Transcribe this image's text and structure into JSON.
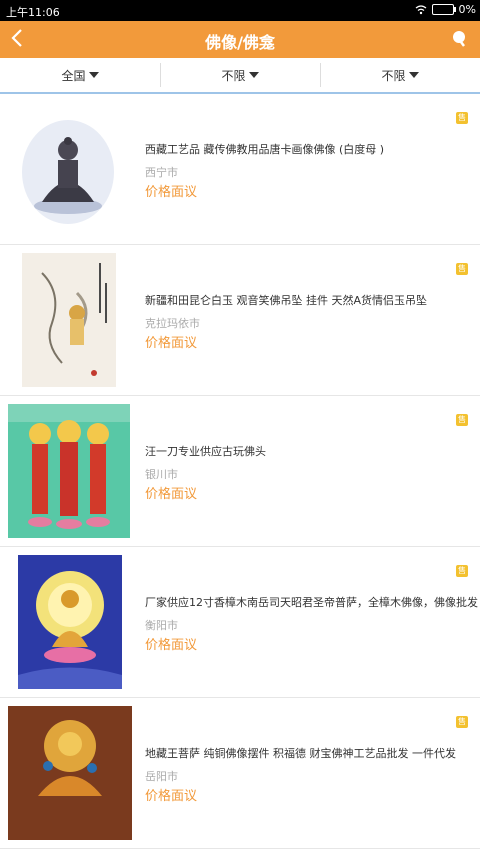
{
  "status": {
    "time": "上午11:06",
    "battery": "0%"
  },
  "header": {
    "title": "佛像/佛龛"
  },
  "filters": [
    {
      "label": "全国"
    },
    {
      "label": "不限"
    },
    {
      "label": "不限"
    }
  ],
  "badge_label": "售",
  "items": [
    {
      "title": "西藏工艺品 藏传佛教用品唐卡画像佛像 (白度母 )",
      "city": "西宁市",
      "price": "价格面议"
    },
    {
      "title": "新疆和田昆仑白玉 观音笑佛吊坠 挂件 天然A货情侣玉吊坠",
      "city": "克拉玛依市",
      "price": "价格面议"
    },
    {
      "title": "汪一刀专业供应古玩佛头",
      "city": "银川市",
      "price": "价格面议"
    },
    {
      "title": "厂家供应12寸香樟木南岳司天昭君圣帝普萨，全樟木佛像，佛像批发",
      "city": "衡阳市",
      "price": "价格面议"
    },
    {
      "title": "地藏王菩萨 纯铜佛像摆件 积福德 财宝佛神工艺品批发 一件代发",
      "city": "岳阳市",
      "price": "价格面议"
    }
  ]
}
